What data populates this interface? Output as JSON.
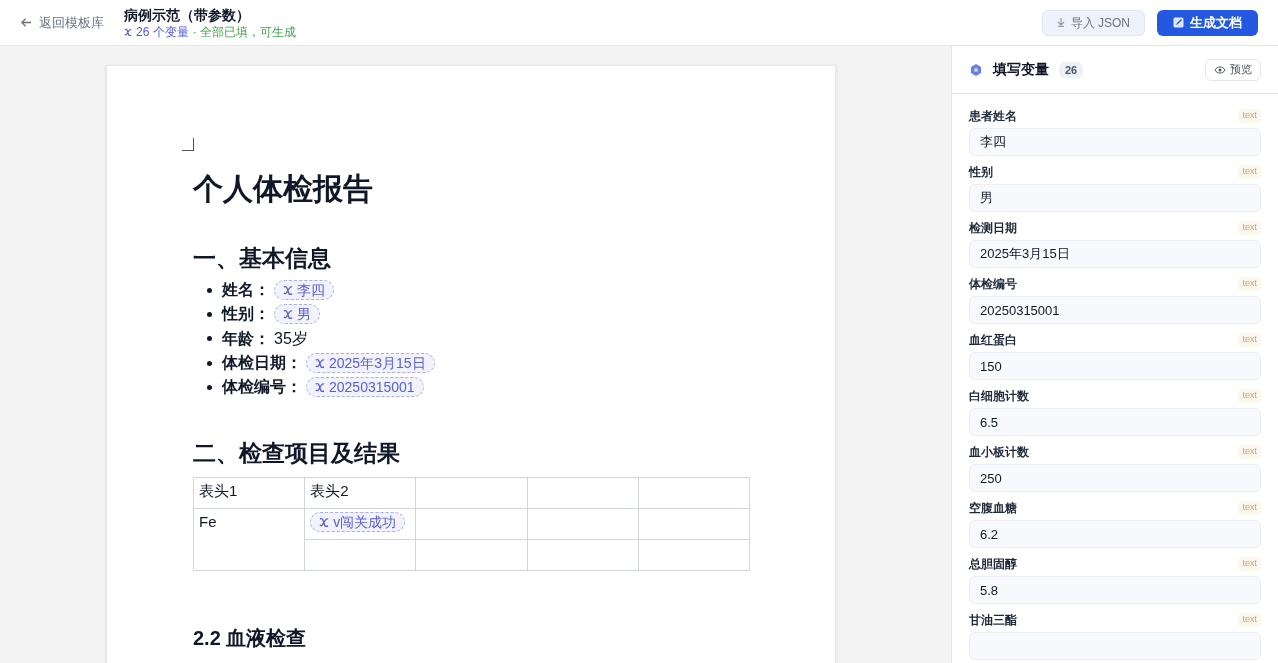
{
  "header": {
    "back_link": "返回模板库",
    "title": "病例示范（带参数）",
    "variable_count": "26 个变量",
    "status": "· 全部已填，可生成",
    "buttons": [
      {
        "kind": "import",
        "label": "导入 JSON"
      },
      {
        "kind": "generate",
        "label": "生成文档"
      }
    ]
  },
  "document": {
    "blocks": [
      {
        "kind": "title",
        "text": "个人体检报告"
      },
      {
        "kind": "heading",
        "text": "一、基本信息"
      },
      {
        "kind": "list",
        "items": [
          {
            "label": "姓名：",
            "value": "李四",
            "variable": true
          },
          {
            "label": "性别：",
            "value": "男",
            "variable": true
          },
          {
            "label": "年龄：",
            "value": "35岁",
            "variable": false
          },
          {
            "label": "体检日期：",
            "value": "2025年3月15日",
            "variable": true
          },
          {
            "label": "体检编号：",
            "value": "20250315001",
            "variable": true
          }
        ]
      },
      {
        "kind": "heading",
        "text": "二、检查项目及结果"
      },
      {
        "kind": "table",
        "rows": [
          [
            {
              "text": "表头1"
            },
            {
              "text": "表头2"
            },
            {},
            {},
            {}
          ],
          [
            {
              "text": "Fe",
              "rowspan": 2
            },
            {
              "text": "v闯关成功",
              "variable": true
            },
            {},
            {},
            {}
          ],
          [
            {},
            {},
            {},
            {}
          ]
        ]
      },
      {
        "kind": "subheading",
        "text": "2.2 血液检查"
      }
    ]
  },
  "panel": {
    "title": "填写变量",
    "count": "26",
    "preview": "预览",
    "fields": [
      {
        "label": "患者姓名",
        "type": "text",
        "value": "李四"
      },
      {
        "label": "性别",
        "type": "text",
        "value": "男"
      },
      {
        "label": "检测日期",
        "type": "text",
        "value": "2025年3月15日"
      },
      {
        "label": "体检编号",
        "type": "text",
        "value": "20250315001"
      },
      {
        "label": "血红蛋白",
        "type": "text",
        "value": "150"
      },
      {
        "label": "白细胞计数",
        "type": "text",
        "value": "6.5"
      },
      {
        "label": "血小板计数",
        "type": "text",
        "value": "250"
      },
      {
        "label": "空腹血糖",
        "type": "text",
        "value": "6.2"
      },
      {
        "label": "总胆固醇",
        "type": "text",
        "value": "5.8"
      },
      {
        "label": "甘油三酯",
        "type": "text"
      }
    ]
  }
}
